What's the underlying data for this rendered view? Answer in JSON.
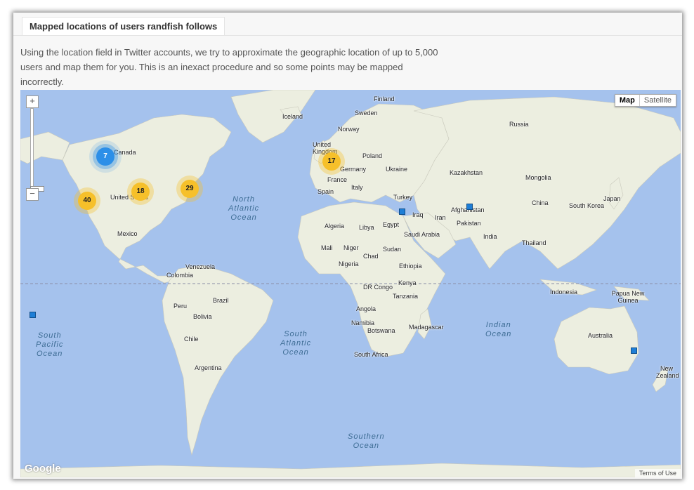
{
  "panel": {
    "tab_title": "Mapped locations of users randfish follows",
    "description": "Using the location field in Twitter accounts, we try to approximate the geographic location of up to 5,000 users and map them for you. This is an inexact procedure and so some points may be mapped incorrectly."
  },
  "map": {
    "type_controls": {
      "map": "Map",
      "satellite": "Satellite"
    },
    "zoom": {
      "in": "+",
      "out": "−"
    },
    "attribution": {
      "logo": "Google",
      "terms": "Terms of Use"
    },
    "clusters": [
      {
        "count": "7",
        "color": "blue"
      },
      {
        "count": "40",
        "color": "yellow"
      },
      {
        "count": "18",
        "color": "yellow"
      },
      {
        "count": "29",
        "color": "yellow"
      },
      {
        "count": "17",
        "color": "yellow"
      }
    ],
    "single_pins_count": 5,
    "oceans": [
      "North Atlantic Ocean",
      "South Pacific Ocean",
      "South Atlantic Ocean",
      "Indian Ocean",
      "Southern Ocean"
    ],
    "labels": [
      "Finland",
      "Iceland",
      "Sweden",
      "Norway",
      "Russia",
      "United Kingdom",
      "Poland",
      "Germany",
      "Ukraine",
      "France",
      "Kazakhstan",
      "Mongolia",
      "Spain",
      "Italy",
      "Turkey",
      "China",
      "South Korea",
      "Japan",
      "Iraq",
      "Iran",
      "Afghanistan",
      "Algeria",
      "Libya",
      "Egypt",
      "Saudi Arabia",
      "Pakistan",
      "India",
      "Mali",
      "Niger",
      "Sudan",
      "Chad",
      "Nigeria",
      "Ethiopia",
      "Thailand",
      "Venezuela",
      "Colombia",
      "Kenya",
      "DR Congo",
      "Tanzania",
      "Indonesia",
      "Papua New Guinea",
      "Peru",
      "Brazil",
      "Bolivia",
      "Angola",
      "Namibia",
      "Botswana",
      "Madagascar",
      "Australia",
      "Chile",
      "South Africa",
      "Argentina",
      "New Zealand",
      "Canada",
      "United States",
      "Mexico"
    ]
  }
}
